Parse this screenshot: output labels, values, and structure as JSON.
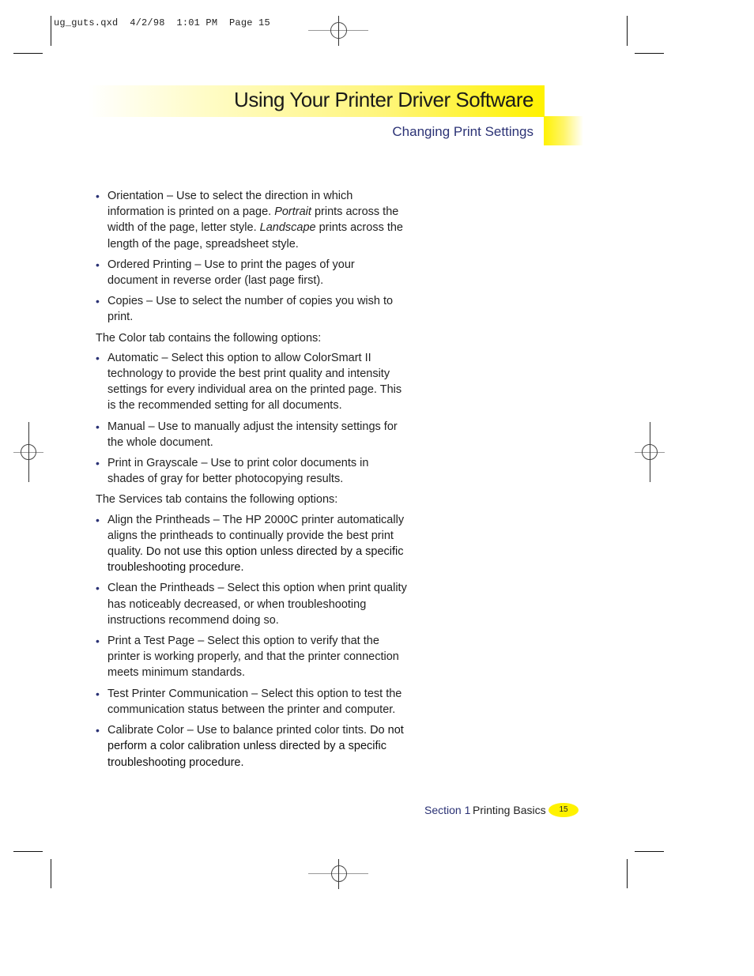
{
  "slug_line": "ug_guts.qxd  4/2/98  1:01 PM  Page 15",
  "header": {
    "title": "Using Your Printer Driver Software",
    "subtitle": "Changing Print Settings"
  },
  "content": {
    "group1": [
      {
        "before": "Orientation – Use to select the direction in which information is printed on a page. ",
        "em1": "Portrait",
        "mid": " prints across the width of the page, letter style. ",
        "em2": "Landscape",
        "after": " prints across the length of the page, spreadsheet style."
      },
      {
        "text": "Ordered Printing – Use to print the pages of your document in reverse order (last page first)."
      },
      {
        "text": "Copies – Use to select the number of copies you wish to print."
      }
    ],
    "color_intro": "The Color tab contains the following options:",
    "color_items": [
      {
        "text": "Automatic – Select this option to allow ColorSmart II technology to provide the best print quality and intensity settings for every individual area on the printed page. This is the recommended setting for all documents."
      },
      {
        "text": "Manual – Use to manually adjust the intensity settings for the whole document."
      },
      {
        "text": "Print in Grayscale – Use to print color documents in shades of gray for better photocopying results."
      }
    ],
    "services_intro": "The Services tab contains the following options:",
    "services_items": [
      {
        "text": "Align the Printheads – The HP 2000C printer automatically aligns the printheads to continually provide the best print quality. ",
        "warning": "Do not use this option unless directed by a specific troubleshooting procedure."
      },
      {
        "text": "Clean the Printheads – Select this option when print quality has noticeably decreased, or when troubleshooting instructions recommend doing so."
      },
      {
        "text": "Print a Test Page – Select this option to verify that the printer is working properly, and that the printer connection meets minimum standards."
      },
      {
        "text": "Test Printer Communication – Select this option to test the communication status between the printer and computer."
      },
      {
        "text": "Calibrate Color – Use to balance printed color tints. ",
        "warning": "Do not perform a color calibration unless directed by a specific troubleshooting procedure."
      }
    ],
    "bullet_glyph": "•"
  },
  "footer": {
    "section": "Section 1",
    "chapter": "Printing Basics",
    "page_number": "15"
  },
  "colors": {
    "accent_yellow": "#fff200",
    "heading_blue": "#2b3275"
  }
}
